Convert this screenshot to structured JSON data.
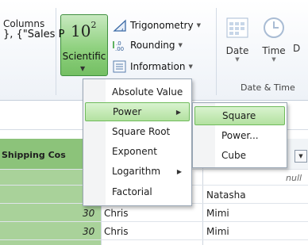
{
  "ribbon": {
    "columns_label": "Columns",
    "scientific": {
      "icon_text": "10",
      "icon_sup": "2",
      "label": "Scientific"
    },
    "trigonometry": "Trigonometry",
    "rounding": "Rounding",
    "information": "Information",
    "date": "Date",
    "time": "Time",
    "duration_partial": "D",
    "group_date_time": "Date & Time"
  },
  "formula_bar": {
    "text": "}, {\"Sales P"
  },
  "grid": {
    "header_col1": "Shipping Cos",
    "null_text": "null",
    "rows": [
      {
        "num": "",
        "name": "",
        "other": "Natasha"
      },
      {
        "num": "30",
        "name": "Chris",
        "other": "Mimi"
      },
      {
        "num": "30",
        "name": "Chris",
        "other": "Mimi"
      }
    ]
  },
  "scientific_menu": {
    "items": [
      {
        "label": "Absolute Value",
        "submenu": false,
        "highlighted": false
      },
      {
        "label": "Power",
        "submenu": true,
        "highlighted": true
      },
      {
        "label": "Square Root",
        "submenu": false,
        "highlighted": false
      },
      {
        "label": "Exponent",
        "submenu": false,
        "highlighted": false
      },
      {
        "label": "Logarithm",
        "submenu": true,
        "highlighted": false
      },
      {
        "label": "Factorial",
        "submenu": false,
        "highlighted": false
      }
    ]
  },
  "power_submenu": {
    "items": [
      {
        "label": "Square",
        "highlighted": true
      },
      {
        "label": "Power...",
        "highlighted": false
      },
      {
        "label": "Cube",
        "highlighted": false
      }
    ]
  },
  "colors": {
    "accent_green": "#8fd17f",
    "column_green": "#a9d29a"
  }
}
